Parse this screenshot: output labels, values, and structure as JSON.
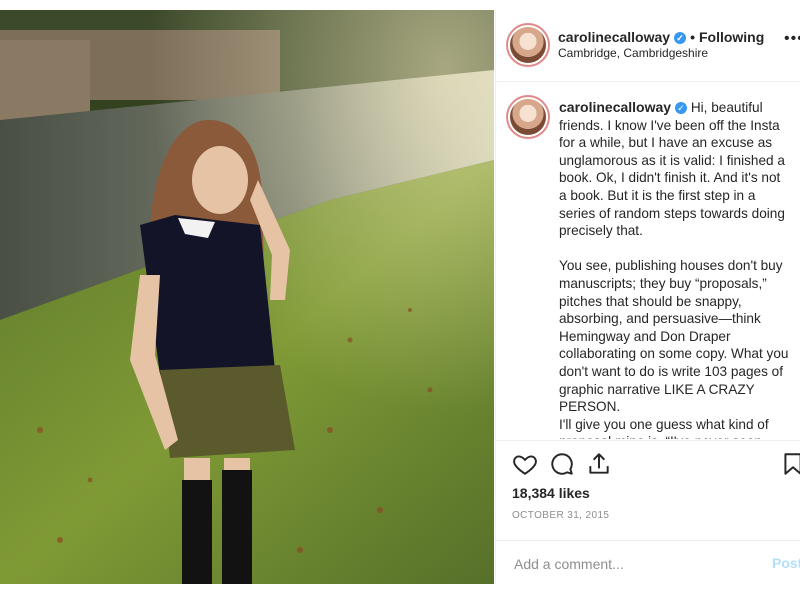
{
  "header": {
    "username": "carolinecalloway",
    "verified_glyph": "✓",
    "separator": "•",
    "follow_status": "Following",
    "location": "Cambridge, Cambridgeshire",
    "more_glyph": "•••"
  },
  "caption": {
    "username": "carolinecalloway",
    "paragraph1": "Hi, beautiful friends. I know I've been off the Insta for a while, but I have an excuse as unglamorous as it is valid: I finished a book. Ok, I didn't finish it. And it's not a book. But it is the first step in a series of random steps towards doing precisely that.",
    "paragraph2": "You see, publishing houses don't buy manuscripts; they buy “proposals,” pitches that should be snappy, absorbing, and persuasive—think Hemingway and Don Draper collaborating on some copy. What you don't want to do is write 103 pages of graphic narrative LIKE A CRAZY PERSON.",
    "paragraph3": "I'll give you one guess what kind of proposal mine is. “I've never seen"
  },
  "actions": {
    "icons": [
      "heart-icon",
      "comment-icon",
      "share-icon",
      "bookmark-icon"
    ]
  },
  "likes": "18,384 likes",
  "date": "OCTOBER 31, 2015",
  "comment_box": {
    "placeholder": "Add a comment...",
    "post_label": "Post"
  },
  "colors": {
    "link_blue": "#3897f0",
    "post_disabled": "#b2dffc",
    "muted": "#8e8e8e"
  }
}
